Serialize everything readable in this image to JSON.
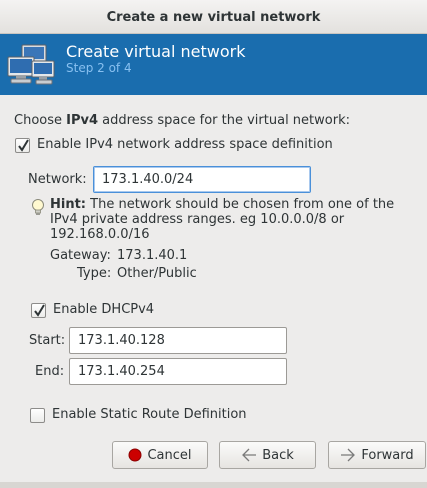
{
  "window": {
    "title": "Create a new virtual network"
  },
  "banner": {
    "title": "Create virtual network",
    "step": "Step 2 of 4",
    "icon": "network-computers-icon"
  },
  "prompt": {
    "prefix": "Choose ",
    "bold": "IPv4",
    "suffix": " address space for the virtual network:"
  },
  "ipv4_enable": {
    "label": "Enable IPv4 network address space definition",
    "checked": true
  },
  "network": {
    "label": "Network:",
    "value": "173.1.40.0/24"
  },
  "hint": {
    "icon": "lightbulb-icon",
    "bold": "Hint:",
    "line1": " The network should be chosen from one of the",
    "line2": "IPv4 private address ranges. eg 10.0.0.0/8 or",
    "line3": "192.168.0.0/16"
  },
  "gateway": {
    "label": "Gateway:",
    "value": "173.1.40.1"
  },
  "type": {
    "label": "Type:",
    "value": "Other/Public"
  },
  "dhcp": {
    "label": "Enable DHCPv4",
    "checked": true,
    "start_label": "Start:",
    "start_value": "173.1.40.128",
    "end_label": "End:",
    "end_value": "173.1.40.254"
  },
  "static_route": {
    "label": "Enable Static Route Definition",
    "checked": false
  },
  "buttons": {
    "cancel": "Cancel",
    "back": "Back",
    "forward": "Forward"
  },
  "colors": {
    "banner": "#1a6dae",
    "step_text": "#88c0f0",
    "cancel_red": "#cc0000"
  }
}
